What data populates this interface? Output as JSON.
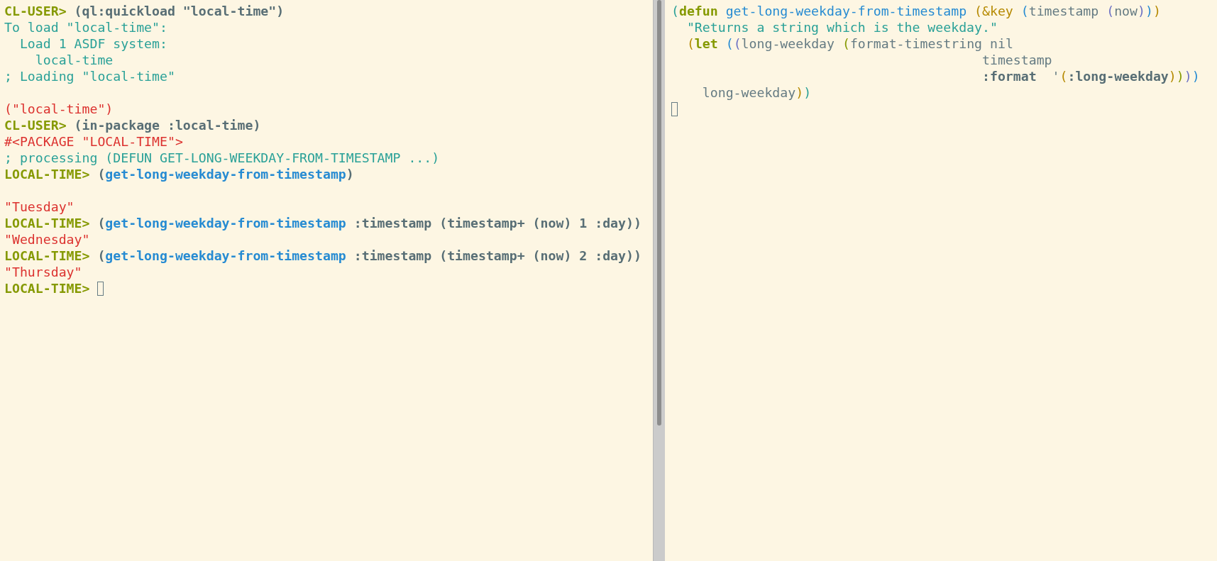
{
  "panes": [
    {
      "kind": "repl",
      "scrollbar": true,
      "lines": [
        {
          "kind": "code",
          "segments": [
            {
              "text": "CL-USER> ",
              "kind": "prompt"
            },
            {
              "text": "(ql:quickload \"local-time\")",
              "kind": "input"
            }
          ]
        },
        {
          "kind": "code",
          "segments": [
            {
              "text": "To load \"local-time\":",
              "kind": "output"
            }
          ]
        },
        {
          "kind": "code",
          "segments": [
            {
              "text": "  Load 1 ASDF system:",
              "kind": "output"
            }
          ]
        },
        {
          "kind": "code",
          "segments": [
            {
              "text": "    local-time",
              "kind": "output"
            }
          ]
        },
        {
          "kind": "code",
          "segments": [
            {
              "text": "; Loading \"local-time\"",
              "kind": "output"
            }
          ]
        },
        {
          "kind": "blank"
        },
        {
          "kind": "code",
          "segments": [
            {
              "text": "(\"local-time\")",
              "kind": "result"
            }
          ]
        },
        {
          "kind": "code",
          "segments": [
            {
              "text": "CL-USER> ",
              "kind": "prompt"
            },
            {
              "text": "(in-package :local-time)",
              "kind": "input"
            }
          ]
        },
        {
          "kind": "code",
          "segments": [
            {
              "text": "#<PACKAGE \"LOCAL-TIME\">",
              "kind": "result"
            }
          ]
        },
        {
          "kind": "code",
          "segments": [
            {
              "text": "; processing (DEFUN GET-LONG-WEEKDAY-FROM-TIMESTAMP ...)",
              "kind": "output"
            }
          ]
        },
        {
          "kind": "code",
          "segments": [
            {
              "text": "LOCAL-TIME> ",
              "kind": "prompt"
            },
            {
              "text": "(",
              "kind": "input"
            },
            {
              "text": "get-long-weekday-from-timestamp",
              "kind": "call"
            },
            {
              "text": ")",
              "kind": "input"
            }
          ]
        },
        {
          "kind": "blank"
        },
        {
          "kind": "code",
          "segments": [
            {
              "text": "\"Tuesday\"",
              "kind": "result"
            }
          ]
        },
        {
          "kind": "code",
          "segments": [
            {
              "text": "LOCAL-TIME> ",
              "kind": "prompt"
            },
            {
              "text": "(",
              "kind": "input"
            },
            {
              "text": "get-long-weekday-from-timestamp",
              "kind": "call"
            },
            {
              "text": " :timestamp (timestamp+ (now) 1 :day))",
              "kind": "input"
            }
          ]
        },
        {
          "kind": "code",
          "segments": [
            {
              "text": "\"Wednesday\"",
              "kind": "result"
            }
          ]
        },
        {
          "kind": "code",
          "segments": [
            {
              "text": "LOCAL-TIME> ",
              "kind": "prompt"
            },
            {
              "text": "(",
              "kind": "input"
            },
            {
              "text": "get-long-weekday-from-timestamp",
              "kind": "call"
            },
            {
              "text": " :timestamp (timestamp+ (now) 2 :day))",
              "kind": "input"
            }
          ]
        },
        {
          "kind": "code",
          "segments": [
            {
              "text": "\"Thursday\"",
              "kind": "result"
            }
          ]
        },
        {
          "kind": "code",
          "cursor": true,
          "segments": [
            {
              "text": "LOCAL-TIME> ",
              "kind": "prompt"
            }
          ]
        }
      ]
    },
    {
      "kind": "editor",
      "lines": [
        {
          "kind": "code",
          "segments": [
            {
              "text": "(",
              "kind": "paren-1"
            },
            {
              "text": "defun",
              "kind": "special"
            },
            {
              "text": " get-long-weekday-from-timestamp",
              "kind": "name"
            },
            {
              "text": " (&key",
              "kind": "paren-2"
            },
            {
              "text": " (",
              "kind": "paren-3"
            },
            {
              "text": "timestamp ",
              "kind": "text"
            },
            {
              "text": "(",
              "kind": "paren-4"
            },
            {
              "text": "now",
              "kind": "text"
            },
            {
              "text": ")",
              "kind": "paren-4"
            },
            {
              "text": ")",
              "kind": "paren-3"
            },
            {
              "text": ")",
              "kind": "paren-2"
            }
          ]
        },
        {
          "kind": "code",
          "segments": [
            {
              "text": "  \"Returns a string which is the weekday.\"",
              "kind": "output"
            }
          ]
        },
        {
          "kind": "code",
          "segments": [
            {
              "text": "  (",
              "kind": "paren-2"
            },
            {
              "text": "let",
              "kind": "special"
            },
            {
              "text": " (",
              "kind": "paren-3"
            },
            {
              "text": "(",
              "kind": "paren-4"
            },
            {
              "text": "long-weekday ",
              "kind": "text"
            },
            {
              "text": "(",
              "kind": "paren-5"
            },
            {
              "text": "format-timestring nil",
              "kind": "text"
            }
          ]
        },
        {
          "kind": "code",
          "segments": [
            {
              "text": "                                        timestamp",
              "kind": "text"
            }
          ]
        },
        {
          "kind": "code",
          "segments": [
            {
              "text": "                                        :format",
              "kind": "input"
            },
            {
              "text": "  '",
              "kind": "text"
            },
            {
              "text": "(",
              "kind": "paren-6"
            },
            {
              "text": ":long-weekday",
              "kind": "input"
            },
            {
              "text": ")",
              "kind": "paren-6"
            },
            {
              "text": ")",
              "kind": "paren-5"
            },
            {
              "text": ")",
              "kind": "paren-4"
            },
            {
              "text": ")",
              "kind": "paren-3"
            }
          ]
        },
        {
          "kind": "code",
          "segments": [
            {
              "text": "    long-weekday",
              "kind": "text"
            },
            {
              "text": ")",
              "kind": "paren-2"
            },
            {
              "text": ")",
              "kind": "paren-1"
            }
          ]
        },
        {
          "kind": "code",
          "cursor": true
        }
      ]
    }
  ]
}
